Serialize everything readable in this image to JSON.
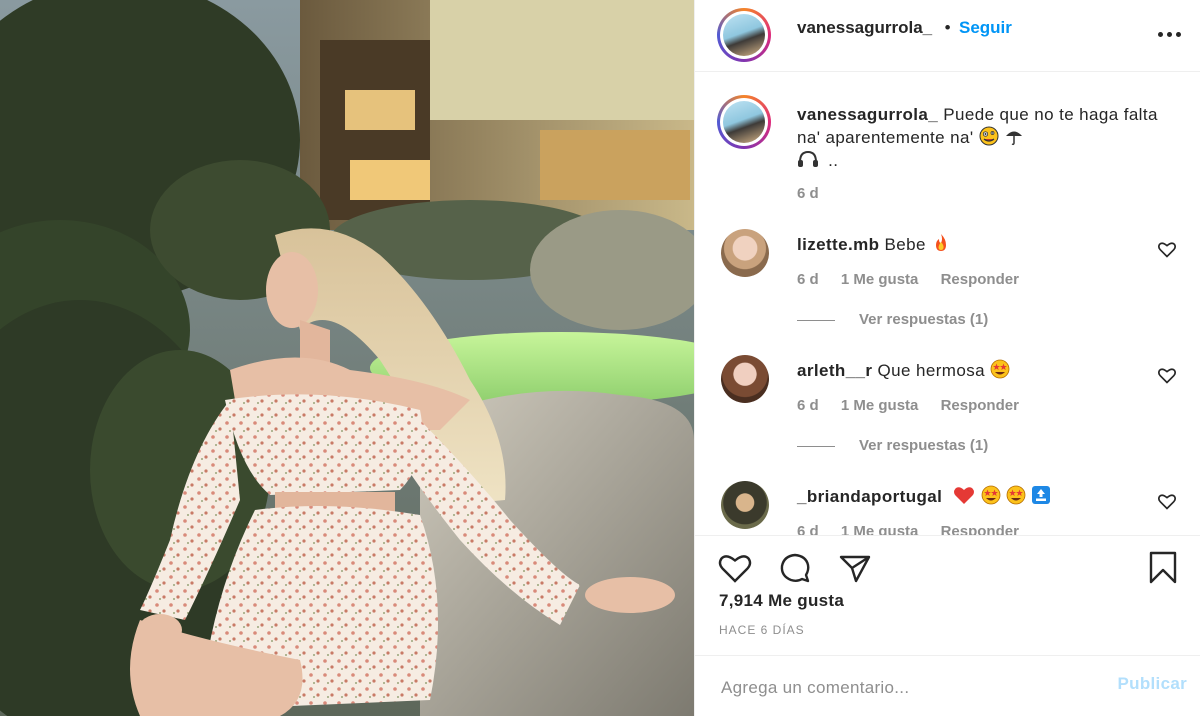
{
  "post": {
    "author": "vanessagurrola_",
    "follow_label": "Seguir",
    "separator": "•",
    "more_icon": "more-horizontal-icon"
  },
  "caption": {
    "username": "vanessagurrola_",
    "text": "Puede que no te haga falta na' aparentemente na'",
    "emojis": [
      "zany-face",
      "umbrella",
      "headphones"
    ],
    "trailing": "..",
    "time": "6 d"
  },
  "comments": [
    {
      "username": "lizette.mb",
      "text": "Bebe",
      "emojis": [
        "fire"
      ],
      "time": "6 d",
      "likes": "1 Me gusta",
      "reply_label": "Responder",
      "view_replies": "Ver respuestas (1)"
    },
    {
      "username": "arleth__r",
      "text": "Que hermosa",
      "emojis": [
        "star-struck"
      ],
      "time": "6 d",
      "likes": "1 Me gusta",
      "reply_label": "Responder",
      "view_replies": "Ver respuestas (1)"
    },
    {
      "username": "_briandaportugal",
      "text": "",
      "emojis": [
        "red-heart",
        "star-struck",
        "star-struck",
        "top-arrow"
      ],
      "time": "6 d",
      "likes": "1 Me gusta",
      "reply_label": "Responder"
    }
  ],
  "actions": {
    "icons": [
      "heart-icon",
      "comment-icon",
      "share-icon",
      "bookmark-icon"
    ],
    "likes_count": "7,914 Me gusta",
    "posted": "HACE 6 DÍAS"
  },
  "comment_box": {
    "placeholder": "Agrega un comentario...",
    "publish_label": "Publicar"
  },
  "colors": {
    "accent": "#0095f6",
    "publish_disabled": "#b2dffc",
    "secondary_text": "#8e8e8e",
    "primary_text": "#262626"
  }
}
